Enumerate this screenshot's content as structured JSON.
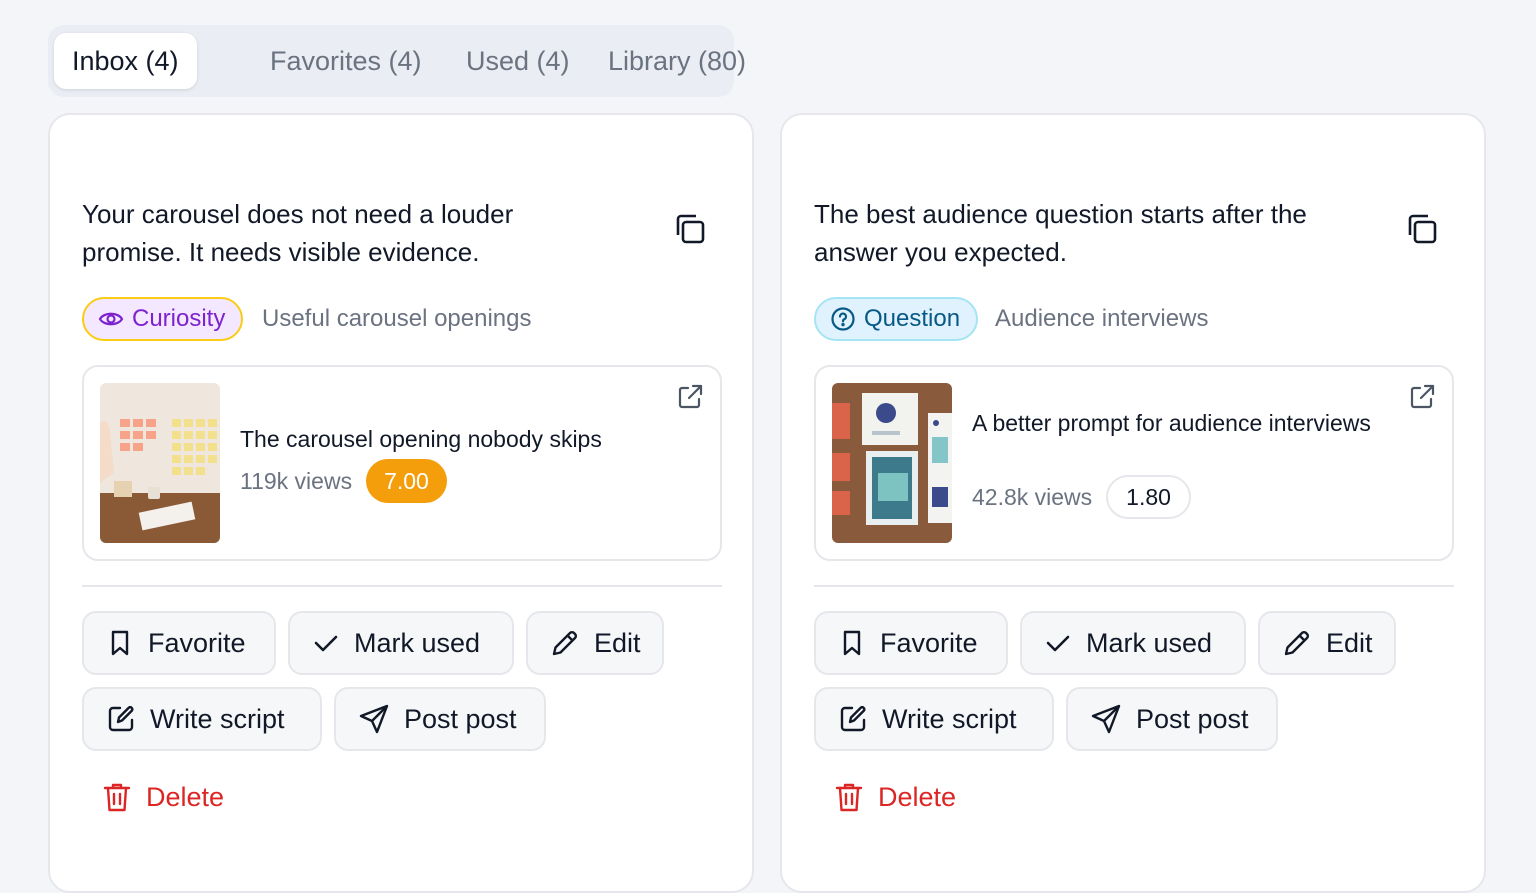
{
  "tabs": [
    {
      "label": "Inbox (4)",
      "active": true
    },
    {
      "label": "Favorites (4)",
      "active": false
    },
    {
      "label": "Used (4)",
      "active": false
    },
    {
      "label": "Library (80)",
      "active": false
    }
  ],
  "cards": [
    {
      "hook": "Your carousel does not need a louder promise. It needs visible evidence.",
      "tag": {
        "label": "Curiosity",
        "icon": "eye-icon"
      },
      "topic": "Useful carousel openings",
      "reference": {
        "title": "The carousel opening nobody skips",
        "views": "119k views",
        "score": "7.00"
      },
      "actions": {
        "favorite": "Favorite",
        "mark_used": "Mark used",
        "edit": "Edit",
        "write_script": "Write script",
        "post": "Post post",
        "delete": "Delete"
      }
    },
    {
      "hook": "The best audience question starts after the answer you expected.",
      "tag": {
        "label": "Question",
        "icon": "question-circle-icon"
      },
      "topic": "Audience interviews",
      "reference": {
        "title": "A better prompt for audience interviews",
        "views": "42.8k views",
        "score": "1.80"
      },
      "actions": {
        "favorite": "Favorite",
        "mark_used": "Mark used",
        "edit": "Edit",
        "write_script": "Write script",
        "post": "Post post",
        "delete": "Delete"
      }
    }
  ],
  "colors": {
    "accent_orange": "#f59e0b",
    "delete_red": "#dc2626",
    "curiosity_purple": "#7e22ce",
    "question_blue": "#075985"
  }
}
